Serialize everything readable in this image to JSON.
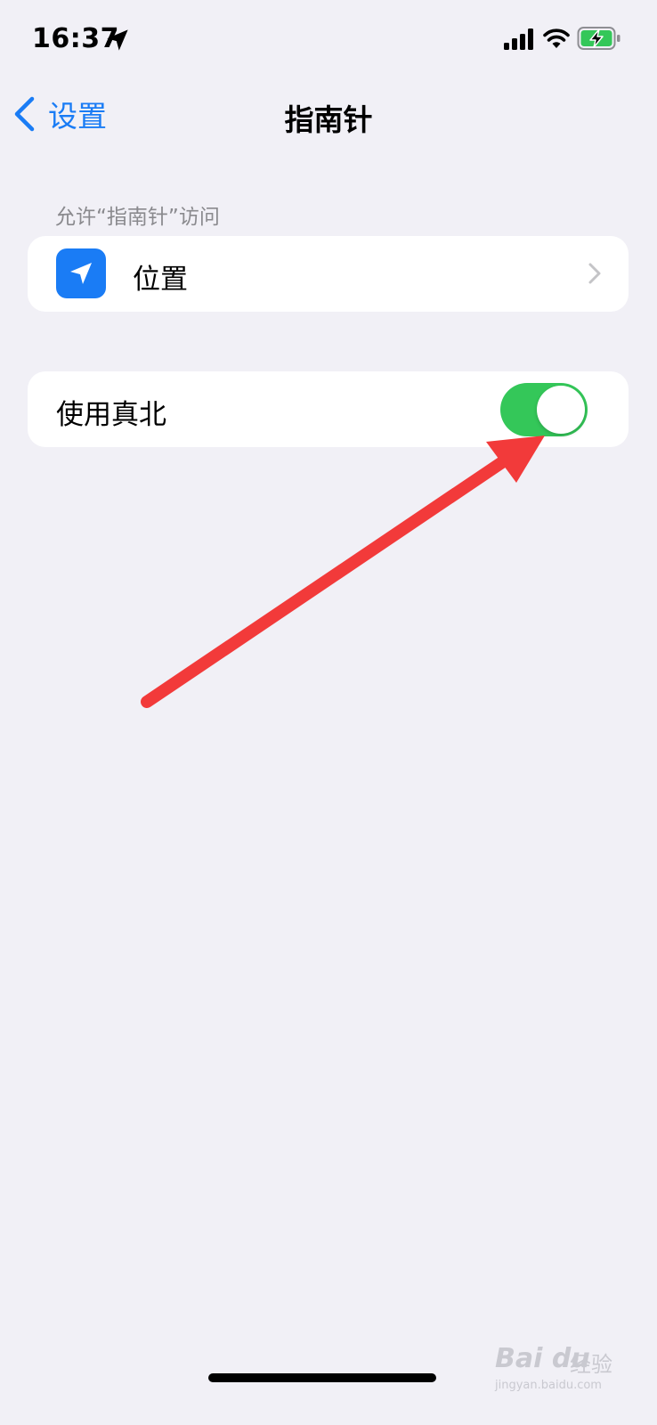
{
  "status": {
    "time": "16:37",
    "icons": [
      "location-arrow-icon",
      "cellular-signal-icon",
      "wifi-icon",
      "battery-charging-icon"
    ]
  },
  "nav": {
    "back_label": "设置",
    "title": "指南针"
  },
  "sections": {
    "access_header": "允许“指南针”访问",
    "location_row": {
      "label": "位置",
      "icon": "location-arrow-icon"
    },
    "true_north_row": {
      "label": "使用真北",
      "toggle_on": true
    }
  },
  "colors": {
    "accent": "#1a7cf5",
    "toggle_on": "#34c759",
    "annotation": "#f23a3a",
    "background": "#f1f0f6"
  },
  "watermark": {
    "brand": "Bai du",
    "text": "经验",
    "url": "jingyan.baidu.com"
  }
}
